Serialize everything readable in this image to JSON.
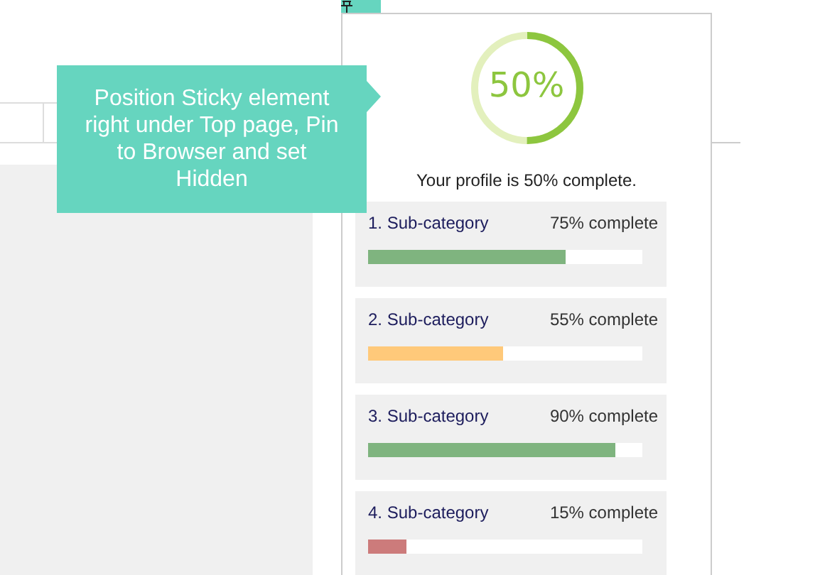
{
  "tooltip": {
    "text": "Position Sticky element right under Top page, Pin to Browser and set Hidden"
  },
  "profile": {
    "ring": {
      "label": "50%"
    },
    "summary": "Your profile is 50% complete.",
    "categories": [
      {
        "name": "1. Sub-category",
        "status": "75% complete",
        "level": 0.72,
        "color": "#7fb47f"
      },
      {
        "name": "2. Sub-category",
        "status": "55% complete",
        "level": 0.49,
        "color": "#ffc97a"
      },
      {
        "name": "3. Sub-category",
        "status": "90% complete",
        "level": 0.9,
        "color": "#7fb47f"
      },
      {
        "name": "4. Sub-category",
        "status": "15% complete",
        "level": 0.14,
        "color": "#cc7b7b"
      }
    ]
  }
}
